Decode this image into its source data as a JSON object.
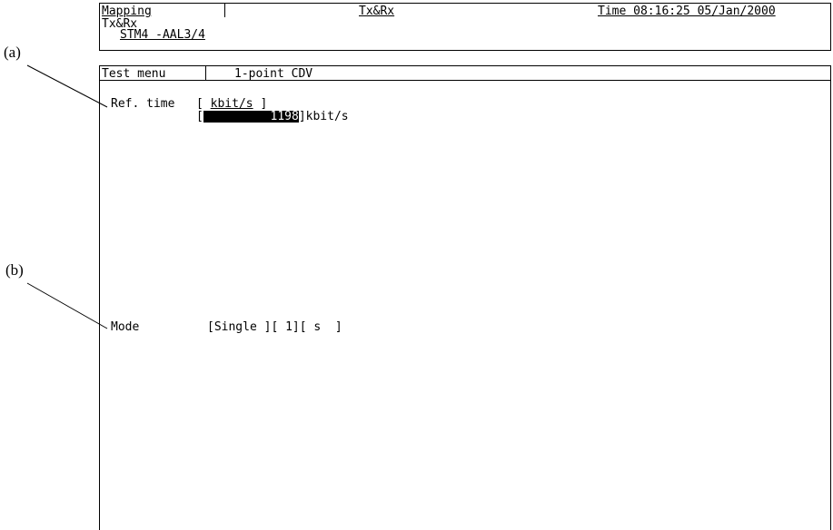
{
  "header": {
    "mapping_label": "Mapping",
    "mode_title": "Tx&Rx",
    "time_text": "Time 08:16:25 05/Jan/2000",
    "line2": "Tx&Rx",
    "line3": "STM4 -AAL3/4"
  },
  "tabs": {
    "test_menu": "Test menu",
    "current": "1-point CDV"
  },
  "ref_time": {
    "label": "Ref. time",
    "unit_open": "[ ",
    "unit_text": "kbit/s",
    "unit_close": " ]",
    "value_open": "[",
    "value": "1198",
    "value_close": "]kbit/s"
  },
  "mode": {
    "label": "Mode",
    "value_text": "[Single ][ 1][ s  ]"
  },
  "callouts": {
    "a": "(a)",
    "b": "(b)"
  }
}
